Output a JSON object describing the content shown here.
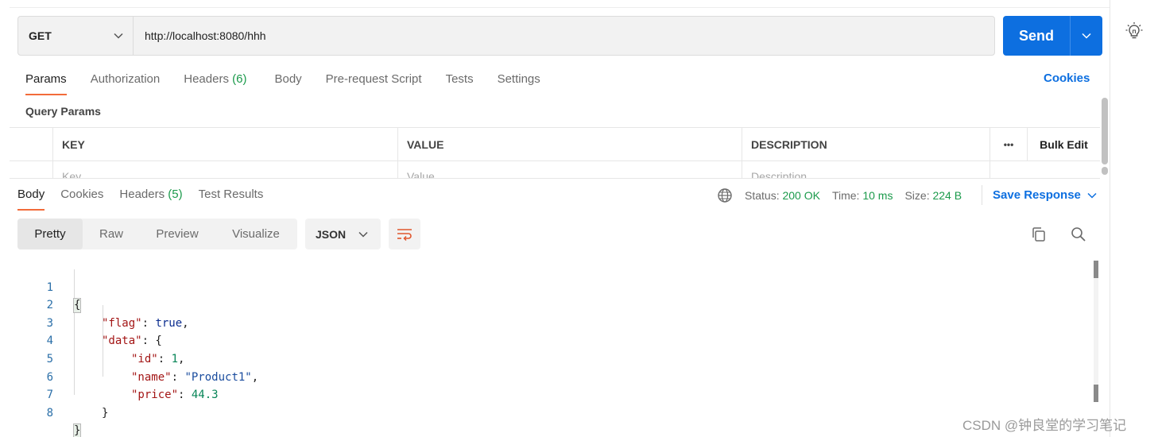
{
  "request": {
    "method": "GET",
    "url": "http://localhost:8080/hhh",
    "send_label": "Send"
  },
  "request_tabs": [
    {
      "label": "Params",
      "active": true
    },
    {
      "label": "Authorization"
    },
    {
      "label": "Headers",
      "count": "(6)"
    },
    {
      "label": "Body"
    },
    {
      "label": "Pre-request Script"
    },
    {
      "label": "Tests"
    },
    {
      "label": "Settings"
    }
  ],
  "cookies_link": "Cookies",
  "query_params": {
    "title": "Query Params",
    "columns": {
      "key": "KEY",
      "value": "VALUE",
      "description": "DESCRIPTION",
      "more": "•••",
      "bulk_edit": "Bulk Edit"
    },
    "placeholders": {
      "key": "Key",
      "value": "Value",
      "description": "Description"
    }
  },
  "response_tabs": [
    {
      "label": "Body",
      "active": true
    },
    {
      "label": "Cookies"
    },
    {
      "label": "Headers",
      "count": "(5)"
    },
    {
      "label": "Test Results"
    }
  ],
  "response_status": {
    "status_label": "Status:",
    "status_value": "200 OK",
    "time_label": "Time:",
    "time_value": "10 ms",
    "size_label": "Size:",
    "size_value": "224 B",
    "save_label": "Save Response"
  },
  "view_modes": [
    {
      "label": "Pretty",
      "active": true
    },
    {
      "label": "Raw"
    },
    {
      "label": "Preview"
    },
    {
      "label": "Visualize"
    }
  ],
  "format": "JSON",
  "code_lines": [
    {
      "n": "1",
      "text": "{"
    },
    {
      "n": "2",
      "text": "\"flag\": true,"
    },
    {
      "n": "3",
      "text": "\"data\": {"
    },
    {
      "n": "4",
      "text": "\"id\": 1,"
    },
    {
      "n": "5",
      "text": "\"name\": \"Product1\","
    },
    {
      "n": "6",
      "text": "\"price\": 44.3"
    },
    {
      "n": "7",
      "text": "}"
    },
    {
      "n": "8",
      "text": "}"
    }
  ],
  "watermark": "CSDN @钟良堂的学习笔记",
  "colors": {
    "accent": "#0d6fe0",
    "active_tab": "#f26b3a",
    "success": "#1b9a4b"
  },
  "icons": [
    "chevron-down-icon",
    "lightbulb-icon",
    "globe-icon",
    "wrap-lines-icon",
    "copy-icon",
    "search-icon"
  ]
}
